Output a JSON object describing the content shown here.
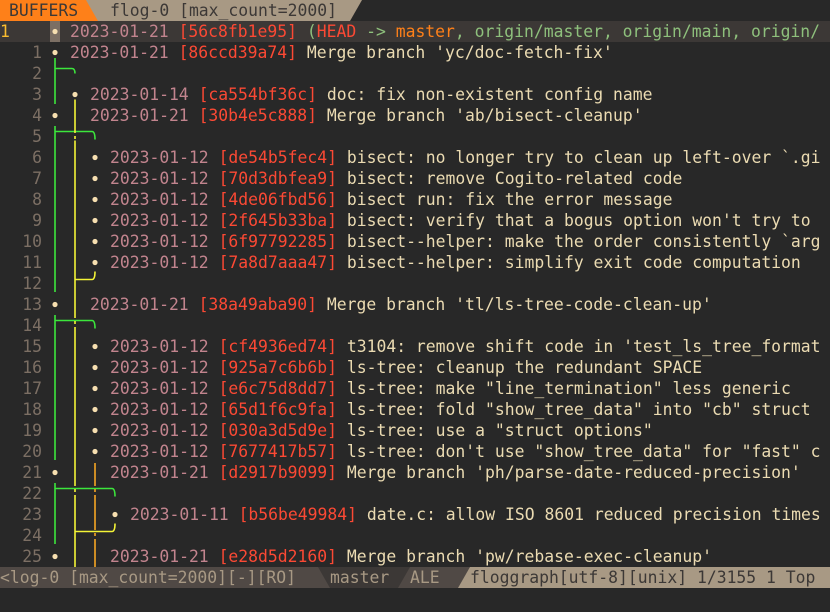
{
  "tabline": {
    "buffers_label": "BUFFERS",
    "active_buffer": "flog-0 [max_count=2000]"
  },
  "editor": {
    "cursor_line": "1",
    "lines": [
      {
        "lnr": "1",
        "date": "2023-01-21",
        "hash": "[56c8fb1e95]",
        "refs": {
          "open": "(",
          "head": "HEAD",
          "arrow": " -> ",
          "branch": "master",
          "remotes": ", origin/master, origin/main, origin/"
        },
        "msg": ""
      },
      {
        "lnr": "1",
        "date": "2023-01-21",
        "hash": "[86ccd39a74]",
        "msg": "Merge branch 'yc/doc-fetch-fix'"
      },
      {
        "lnr": "2"
      },
      {
        "lnr": "3",
        "date": "2023-01-14",
        "hash": "[ca554bf36c]",
        "msg": "doc: fix non-existent config name"
      },
      {
        "lnr": "4",
        "date": "2023-01-21",
        "hash": "[30b4e5c888]",
        "msg": "Merge branch 'ab/bisect-cleanup'"
      },
      {
        "lnr": "5"
      },
      {
        "lnr": "6",
        "date": "2023-01-12",
        "hash": "[de54b5fec4]",
        "msg": "bisect: no longer try to clean up left-over `.gi"
      },
      {
        "lnr": "7",
        "date": "2023-01-12",
        "hash": "[70d3dbfea9]",
        "msg": "bisect: remove Cogito-related code"
      },
      {
        "lnr": "8",
        "date": "2023-01-12",
        "hash": "[4de06fbd56]",
        "msg": "bisect run: fix the error message"
      },
      {
        "lnr": "9",
        "date": "2023-01-12",
        "hash": "[2f645b33ba]",
        "msg": "bisect: verify that a bogus option won't try to"
      },
      {
        "lnr": "10",
        "date": "2023-01-12",
        "hash": "[6f97792285]",
        "msg": "bisect--helper: make the order consistently `arg"
      },
      {
        "lnr": "11",
        "date": "2023-01-12",
        "hash": "[7a8d7aaa47]",
        "msg": "bisect--helper: simplify exit code computation"
      },
      {
        "lnr": "12"
      },
      {
        "lnr": "13",
        "date": "2023-01-21",
        "hash": "[38a49aba90]",
        "msg": "Merge branch 'tl/ls-tree-code-clean-up'"
      },
      {
        "lnr": "14"
      },
      {
        "lnr": "15",
        "date": "2023-01-12",
        "hash": "[cf4936ed74]",
        "msg": "t3104: remove shift code in 'test_ls_tree_format"
      },
      {
        "lnr": "16",
        "date": "2023-01-12",
        "hash": "[925a7c6b6b]",
        "msg": "ls-tree: cleanup the redundant SPACE"
      },
      {
        "lnr": "17",
        "date": "2023-01-12",
        "hash": "[e6c75d8dd7]",
        "msg": "ls-tree: make \"line_termination\" less generic"
      },
      {
        "lnr": "18",
        "date": "2023-01-12",
        "hash": "[65d1f6c9fa]",
        "msg": "ls-tree: fold \"show_tree_data\" into \"cb\" struct"
      },
      {
        "lnr": "19",
        "date": "2023-01-12",
        "hash": "[030a3d5d9e]",
        "msg": "ls-tree: use a \"struct options\""
      },
      {
        "lnr": "20",
        "date": "2023-01-12",
        "hash": "[7677417b57]",
        "msg": "ls-tree: don't use \"show_tree_data\" for \"fast\" c"
      },
      {
        "lnr": "21",
        "date": "2023-01-21",
        "hash": "[d2917b9099]",
        "msg": "Merge branch 'ph/parse-date-reduced-precision'"
      },
      {
        "lnr": "22"
      },
      {
        "lnr": "23",
        "date": "2023-01-11",
        "hash": "[b56be49984]",
        "msg": "date.c: allow ISO 8601 reduced precision times"
      },
      {
        "lnr": "24"
      },
      {
        "lnr": "25",
        "date": "2023-01-21",
        "hash": "[e28d5d2160]",
        "msg": "Merge branch 'pw/rebase-exec-cleanup'"
      }
    ]
  },
  "graph": {
    "colors": {
      "green": "#3ce63c",
      "yellow": "#f4f436",
      "orange": "#f5a623",
      "node": "#f7dfb0"
    }
  },
  "statusline": {
    "left": "<log-0 [max_count=2000][-][RO]",
    "branch": "master",
    "linter": "ALE",
    "right": "floggraph[utf-8][unix] 1/3155 1 Top"
  },
  "colors": {
    "background": "#282828",
    "tab_buffers_bg": "#fe8019",
    "tab_active_bg": "#a89984",
    "hash": "#fb4934",
    "date": "#c2848e"
  }
}
